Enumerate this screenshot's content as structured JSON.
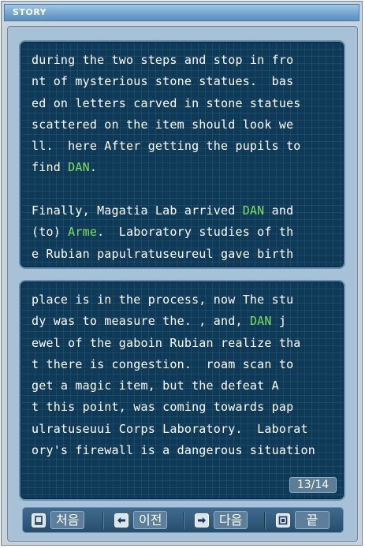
{
  "window": {
    "title": "STORY"
  },
  "story": {
    "top_lines": [
      [
        {
          "t": "during the two steps and stop in fro"
        }
      ],
      [
        {
          "t": "nt of mysterious stone statues.  bas"
        }
      ],
      [
        {
          "t": "ed on letters carved in stone statues"
        }
      ],
      [
        {
          "t": "scattered on the item should look we"
        }
      ],
      [
        {
          "t": "ll.  here After getting the pupils to"
        }
      ],
      [
        {
          "t": "find "
        },
        {
          "t": "DAN",
          "hl": true
        },
        {
          "t": "."
        }
      ],
      [
        {
          "t": ""
        }
      ],
      [
        {
          "t": "Finally, Magatia Lab arrived "
        },
        {
          "t": "DAN",
          "hl": true
        },
        {
          "t": " and"
        }
      ],
      [
        {
          "t": "(to) "
        },
        {
          "t": "Arme",
          "hl": true
        },
        {
          "t": ".  Laboratory studies of th"
        }
      ],
      [
        {
          "t": "e Rubian papulratuseureul gave birth"
        }
      ]
    ],
    "bottom_lines": [
      [
        {
          "t": "place is in the process, now The stu"
        }
      ],
      [
        {
          "t": "dy was to measure the. , and, "
        },
        {
          "t": "DAN",
          "hl": true
        },
        {
          "t": " j"
        }
      ],
      [
        {
          "t": "ewel of the gaboin Rubian realize tha"
        }
      ],
      [
        {
          "t": "t there is congestion.  roam scan to"
        }
      ],
      [
        {
          "t": "get a magic item, but the defeat A"
        }
      ],
      [
        {
          "t": "t this point, was coming towards pap"
        }
      ],
      [
        {
          "t": "ulratuseuui Corps Laboratory.  Laborat"
        }
      ],
      [
        {
          "t": "ory's firewall is a dangerous situation"
        }
      ]
    ],
    "highlight_color": "#7fe05a"
  },
  "pagination": {
    "label": "13/14"
  },
  "nav": {
    "first": {
      "label": "처음",
      "icon": "first-page-icon"
    },
    "prev": {
      "label": "이전",
      "icon": "prev-arrow-icon"
    },
    "next": {
      "label": "다음",
      "icon": "next-arrow-icon"
    },
    "end": {
      "label": "끝",
      "icon": "close-book-icon"
    }
  }
}
